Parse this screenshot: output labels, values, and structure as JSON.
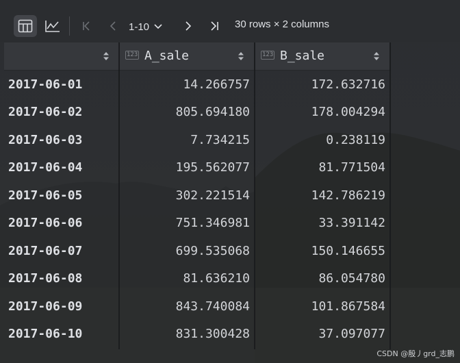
{
  "toolbar": {
    "table_view_icon": "table-icon",
    "chart_view_icon": "line-chart-icon",
    "page_range": "1-10",
    "page_info": "30 rows × 2 columns"
  },
  "table": {
    "columns": [
      {
        "name": "",
        "type_badge": ""
      },
      {
        "name": "A_sale",
        "type_badge": "123"
      },
      {
        "name": "B_sale",
        "type_badge": "123"
      }
    ],
    "rows": [
      {
        "index": "2017-06-01",
        "a": "14.266757",
        "b": "172.632716"
      },
      {
        "index": "2017-06-02",
        "a": "805.694180",
        "b": "178.004294"
      },
      {
        "index": "2017-06-03",
        "a": "7.734215",
        "b": "0.238119"
      },
      {
        "index": "2017-06-04",
        "a": "195.562077",
        "b": "81.771504"
      },
      {
        "index": "2017-06-05",
        "a": "302.221514",
        "b": "142.786219"
      },
      {
        "index": "2017-06-06",
        "a": "751.346981",
        "b": "33.391142"
      },
      {
        "index": "2017-06-07",
        "a": "699.535068",
        "b": "150.146655"
      },
      {
        "index": "2017-06-08",
        "a": "81.636210",
        "b": "86.054780"
      },
      {
        "index": "2017-06-09",
        "a": "843.740084",
        "b": "101.867584"
      },
      {
        "index": "2017-06-10",
        "a": "831.300428",
        "b": "37.097077"
      }
    ]
  },
  "watermark": "CSDN @殷丿grd_志鹏",
  "colors": {
    "background": "#2b2d30",
    "header": "#36383c",
    "text": "#dfe1e5"
  }
}
